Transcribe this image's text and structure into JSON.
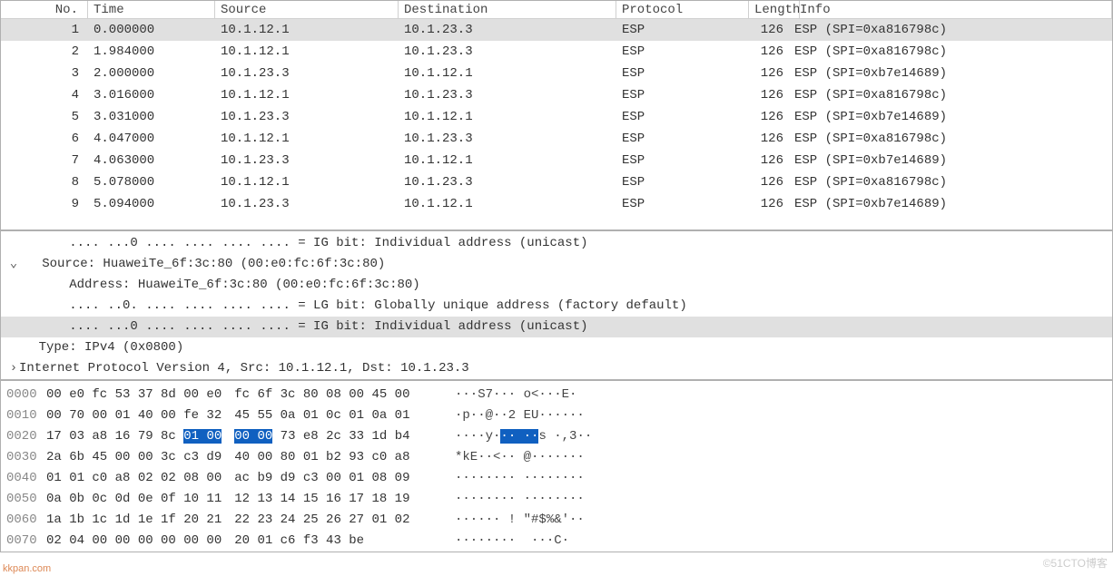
{
  "columns": {
    "no": "No.",
    "time": "Time",
    "source": "Source",
    "destination": "Destination",
    "protocol": "Protocol",
    "length": "Length",
    "info": "Info"
  },
  "packets": [
    {
      "no": "1",
      "time": "0.000000",
      "src": "10.1.12.1",
      "dst": "10.1.23.3",
      "proto": "ESP",
      "len": "126",
      "info": "ESP (SPI=0xa816798c)",
      "selected": true
    },
    {
      "no": "2",
      "time": "1.984000",
      "src": "10.1.12.1",
      "dst": "10.1.23.3",
      "proto": "ESP",
      "len": "126",
      "info": "ESP (SPI=0xa816798c)"
    },
    {
      "no": "3",
      "time": "2.000000",
      "src": "10.1.23.3",
      "dst": "10.1.12.1",
      "proto": "ESP",
      "len": "126",
      "info": "ESP (SPI=0xb7e14689)"
    },
    {
      "no": "4",
      "time": "3.016000",
      "src": "10.1.12.1",
      "dst": "10.1.23.3",
      "proto": "ESP",
      "len": "126",
      "info": "ESP (SPI=0xa816798c)"
    },
    {
      "no": "5",
      "time": "3.031000",
      "src": "10.1.23.3",
      "dst": "10.1.12.1",
      "proto": "ESP",
      "len": "126",
      "info": "ESP (SPI=0xb7e14689)"
    },
    {
      "no": "6",
      "time": "4.047000",
      "src": "10.1.12.1",
      "dst": "10.1.23.3",
      "proto": "ESP",
      "len": "126",
      "info": "ESP (SPI=0xa816798c)"
    },
    {
      "no": "7",
      "time": "4.063000",
      "src": "10.1.23.3",
      "dst": "10.1.12.1",
      "proto": "ESP",
      "len": "126",
      "info": "ESP (SPI=0xb7e14689)"
    },
    {
      "no": "8",
      "time": "5.078000",
      "src": "10.1.12.1",
      "dst": "10.1.23.3",
      "proto": "ESP",
      "len": "126",
      "info": "ESP (SPI=0xa816798c)"
    },
    {
      "no": "9",
      "time": "5.094000",
      "src": "10.1.23.3",
      "dst": "10.1.12.1",
      "proto": "ESP",
      "len": "126",
      "info": "ESP (SPI=0xb7e14689)"
    }
  ],
  "details": {
    "l0": "        .... ...0 .... .... .... .... = IG bit: Individual address (unicast)",
    "l1": "Source: HuaweiTe_6f:3c:80 (00:e0:fc:6f:3c:80)",
    "l2": "        Address: HuaweiTe_6f:3c:80 (00:e0:fc:6f:3c:80)",
    "l3": "        .... ..0. .... .... .... .... = LG bit: Globally unique address (factory default)",
    "l4": "        .... ...0 .... .... .... .... = IG bit: Individual address (unicast)",
    "l5": "    Type: IPv4 (0x0800)",
    "l6": "Internet Protocol Version 4, Src: 10.1.12.1, Dst: 10.1.23.3"
  },
  "hex": [
    {
      "off": "0000",
      "b1": "00 e0 fc 53 37 8d 00 e0",
      "b2": "fc 6f 3c 80 08 00 45 00",
      "asc": "···S7··· o<···E·"
    },
    {
      "off": "0010",
      "b1": "00 70 00 01 40 00 fe 32",
      "b2": "45 55 0a 01 0c 01 0a 01",
      "asc": "·p··@··2 EU······"
    },
    {
      "off": "0020",
      "b1": "17 03 a8 16 79 8c ",
      "sel": "01 00",
      "b2s": "00 00",
      "b2r": " 73 e8 2c 33 1d b4",
      "asc_pre": "····y·",
      "asc_sel": "·· ··",
      "asc_post": "s ·,3··"
    },
    {
      "off": "0030",
      "b1": "2a 6b 45 00 00 3c c3 d9",
      "b2": "40 00 80 01 b2 93 c0 a8",
      "asc": "*kE··<·· @·······"
    },
    {
      "off": "0040",
      "b1": "01 01 c0 a8 02 02 08 00",
      "b2": "ac b9 d9 c3 00 01 08 09",
      "asc": "········ ········"
    },
    {
      "off": "0050",
      "b1": "0a 0b 0c 0d 0e 0f 10 11",
      "b2": "12 13 14 15 16 17 18 19",
      "asc": "········ ········"
    },
    {
      "off": "0060",
      "b1": "1a 1b 1c 1d 1e 1f 20 21",
      "b2": "22 23 24 25 26 27 01 02",
      "asc": "······ ! \"#$%&'··"
    },
    {
      "off": "0070",
      "b1": "02 04 00 00 00 00 00 00",
      "b2": "20 01 c6 f3 43 be",
      "asc": "········  ···C·"
    }
  ],
  "watermarks": {
    "left": "kkpan.com",
    "right": "©51CTO博客"
  }
}
